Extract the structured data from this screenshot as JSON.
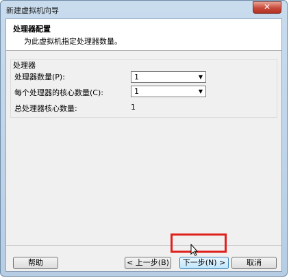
{
  "window": {
    "title": "新建虚拟机向导",
    "close_glyph": "✕"
  },
  "header": {
    "title": "处理器配置",
    "subtitle": "为此虚拟机指定处理器数量。"
  },
  "processor_group": {
    "label": "处理器",
    "processor_count_label": "处理器数量(P):",
    "processor_count_value": "1",
    "cores_per_processor_label": "每个处理器的核心数量(C):",
    "cores_per_processor_value": "1",
    "total_cores_label": "总处理器核心数量:",
    "total_cores_value": "1"
  },
  "buttons": {
    "help": "帮助",
    "back": "< 上一步(B)",
    "next": "下一步(N) >",
    "cancel": "取消"
  },
  "colors": {
    "highlight": "#e0201c",
    "close_button": "#c8493a"
  },
  "icons": {
    "dropdown": "chevron-down-icon",
    "cursor": "mouse-pointer-icon"
  }
}
